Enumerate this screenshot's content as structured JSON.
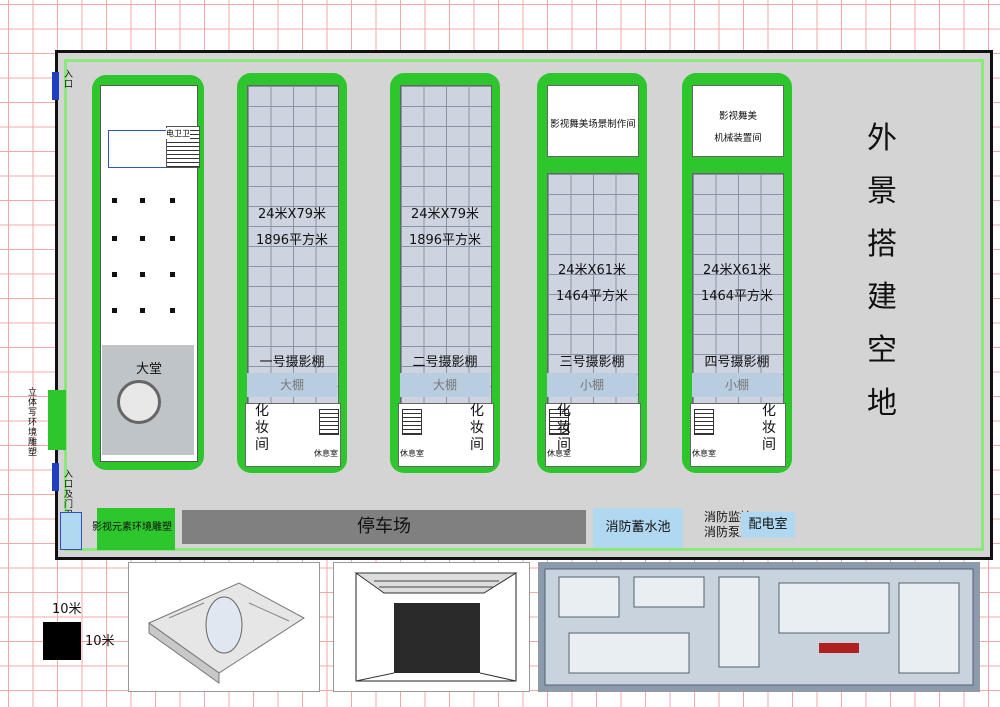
{
  "labels": {
    "entry_top": "入口",
    "sculpture_left": "立体写环境雕塑",
    "entry_gate": "入口及门卫",
    "sculpture_bottom": "影视元素环境雕塑",
    "lobby": "大堂",
    "restroom": "电卫卫",
    "parking": "停车场",
    "fire_pool": "消防蓄水池",
    "fire_control": "消防监控",
    "fire_pump": "消防泵房",
    "power_room": "配电室",
    "outdoor_area": "外景搭建空地",
    "scale_top": "10米",
    "scale_side": "10米"
  },
  "studios": [
    {
      "name": "一号摄影棚",
      "dim": "24米X79米",
      "area": "1896平方米",
      "small": "大棚",
      "makeup": "化妆间",
      "rest": "休息室",
      "upper": ""
    },
    {
      "name": "二号摄影棚",
      "dim": "24米X79米",
      "area": "1896平方米",
      "small": "大棚",
      "makeup": "化妆间",
      "rest": "休息室",
      "upper": ""
    },
    {
      "name": "三号摄影棚",
      "dim": "24米X61米",
      "area": "1464平方米",
      "small": "小棚",
      "makeup": "化妆间",
      "rest": "休息室",
      "upper": "影视舞美场景制作间"
    },
    {
      "name": "四号摄影棚",
      "dim": "24米X61米",
      "area": "1464平方米",
      "small": "小棚",
      "makeup": "化妆间",
      "rest": "休息室",
      "upper_line1": "影视舞美",
      "upper_line2": "机械装置间"
    }
  ]
}
